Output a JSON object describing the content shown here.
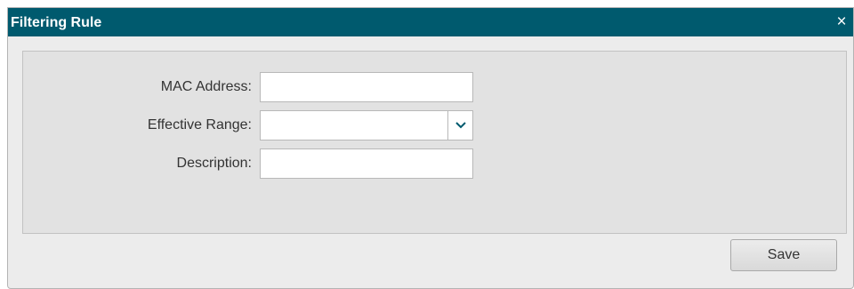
{
  "dialog": {
    "title": "Filtering Rule",
    "close_glyph": "×",
    "close_icon": "close-icon"
  },
  "form": {
    "mac_address": {
      "label": "MAC Address:",
      "value": ""
    },
    "effective_range": {
      "label": "Effective Range:",
      "selected": "",
      "arrow_icon": "chevron-down-icon"
    },
    "description": {
      "label": "Description:",
      "value": ""
    }
  },
  "actions": {
    "save_label": "Save"
  },
  "colors": {
    "titlebar": "#005a6e",
    "dropdown_arrow": "#005a6e"
  }
}
